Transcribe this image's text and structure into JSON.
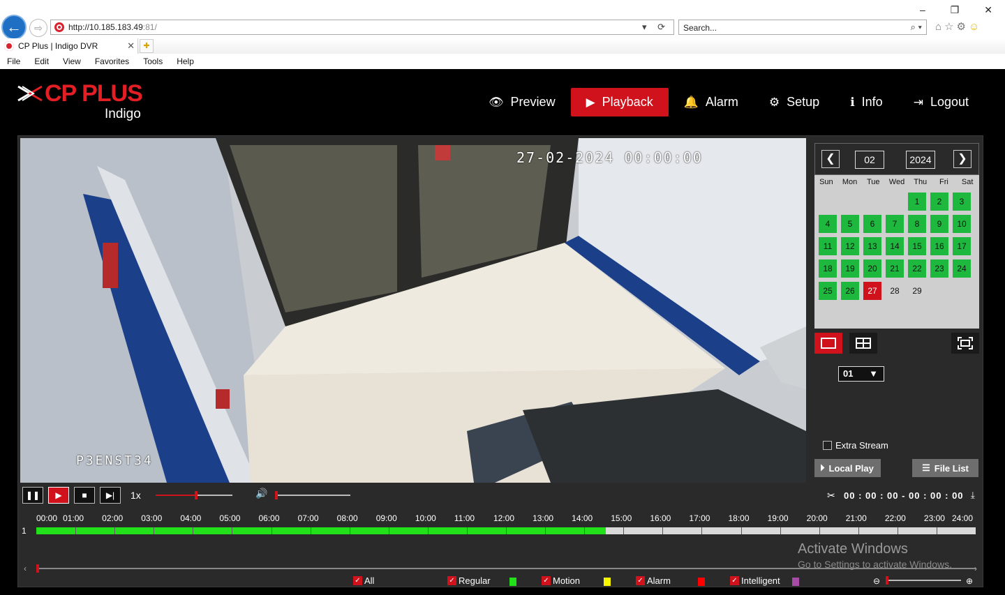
{
  "browser": {
    "url_host": "http://10.185.183.49",
    "url_rest": ":81/",
    "search_placeholder": "Search...",
    "tab_title": "CP Plus | Indigo DVR",
    "menu": [
      "File",
      "Edit",
      "View",
      "Favorites",
      "Tools",
      "Help"
    ]
  },
  "header": {
    "brand": "CP PLUS",
    "sub_brand": "Indigo",
    "nav": [
      {
        "label": "Preview",
        "icon": "eye-icon"
      },
      {
        "label": "Playback",
        "icon": "play-circle-icon",
        "active": true
      },
      {
        "label": "Alarm",
        "icon": "bell-icon"
      },
      {
        "label": "Setup",
        "icon": "gear-icon"
      },
      {
        "label": "Info",
        "icon": "info-icon"
      },
      {
        "label": "Logout",
        "icon": "logout-icon"
      }
    ]
  },
  "video": {
    "osd_time": "27-02-2024 00:00:00",
    "osd_name": "P3ENST34"
  },
  "calendar": {
    "month": "02",
    "year": "2024",
    "weekdays": [
      "Sun",
      "Mon",
      "Tue",
      "Wed",
      "Thu",
      "Fri",
      "Sat"
    ],
    "first_weekday_index": 4,
    "days_in_month": 29,
    "recorded_days": [
      1,
      2,
      3,
      4,
      5,
      6,
      7,
      8,
      9,
      10,
      11,
      12,
      13,
      14,
      15,
      16,
      17,
      18,
      19,
      20,
      21,
      22,
      23,
      24,
      25,
      26
    ],
    "selected_day": 27
  },
  "sidebar": {
    "channel": "01",
    "extra_stream_label": "Extra Stream",
    "local_play_label": "Local Play",
    "file_list_label": "File List"
  },
  "controls": {
    "speed": "1x",
    "speed_level": 0.52,
    "volume_level": 0,
    "clip_time": "00 : 00 : 00 - 00 : 00 : 00"
  },
  "timeline": {
    "channel_label": "1",
    "hour_labels": [
      "00:00",
      "01:00",
      "02:00",
      "03:00",
      "04:00",
      "05:00",
      "06:00",
      "07:00",
      "08:00",
      "09:00",
      "10:00",
      "11:00",
      "12:00",
      "13:00",
      "14:00",
      "15:00",
      "16:00",
      "17:00",
      "18:00",
      "19:00",
      "20:00",
      "21:00",
      "22:00",
      "23:00",
      "24:00"
    ],
    "recorded_until_hour": 14.55,
    "scroll_level": 0,
    "zoom_level": 0
  },
  "legend": [
    {
      "label": "All",
      "color": ""
    },
    {
      "label": "Regular",
      "color": "#22e01a"
    },
    {
      "label": "Motion",
      "color": "#f5f500"
    },
    {
      "label": "Alarm",
      "color": "#ff0000"
    },
    {
      "label": "Intelligent",
      "color": "#a64ca6"
    }
  ],
  "watermark": {
    "line1": "Activate Windows",
    "line2": "Go to Settings to activate Windows."
  }
}
